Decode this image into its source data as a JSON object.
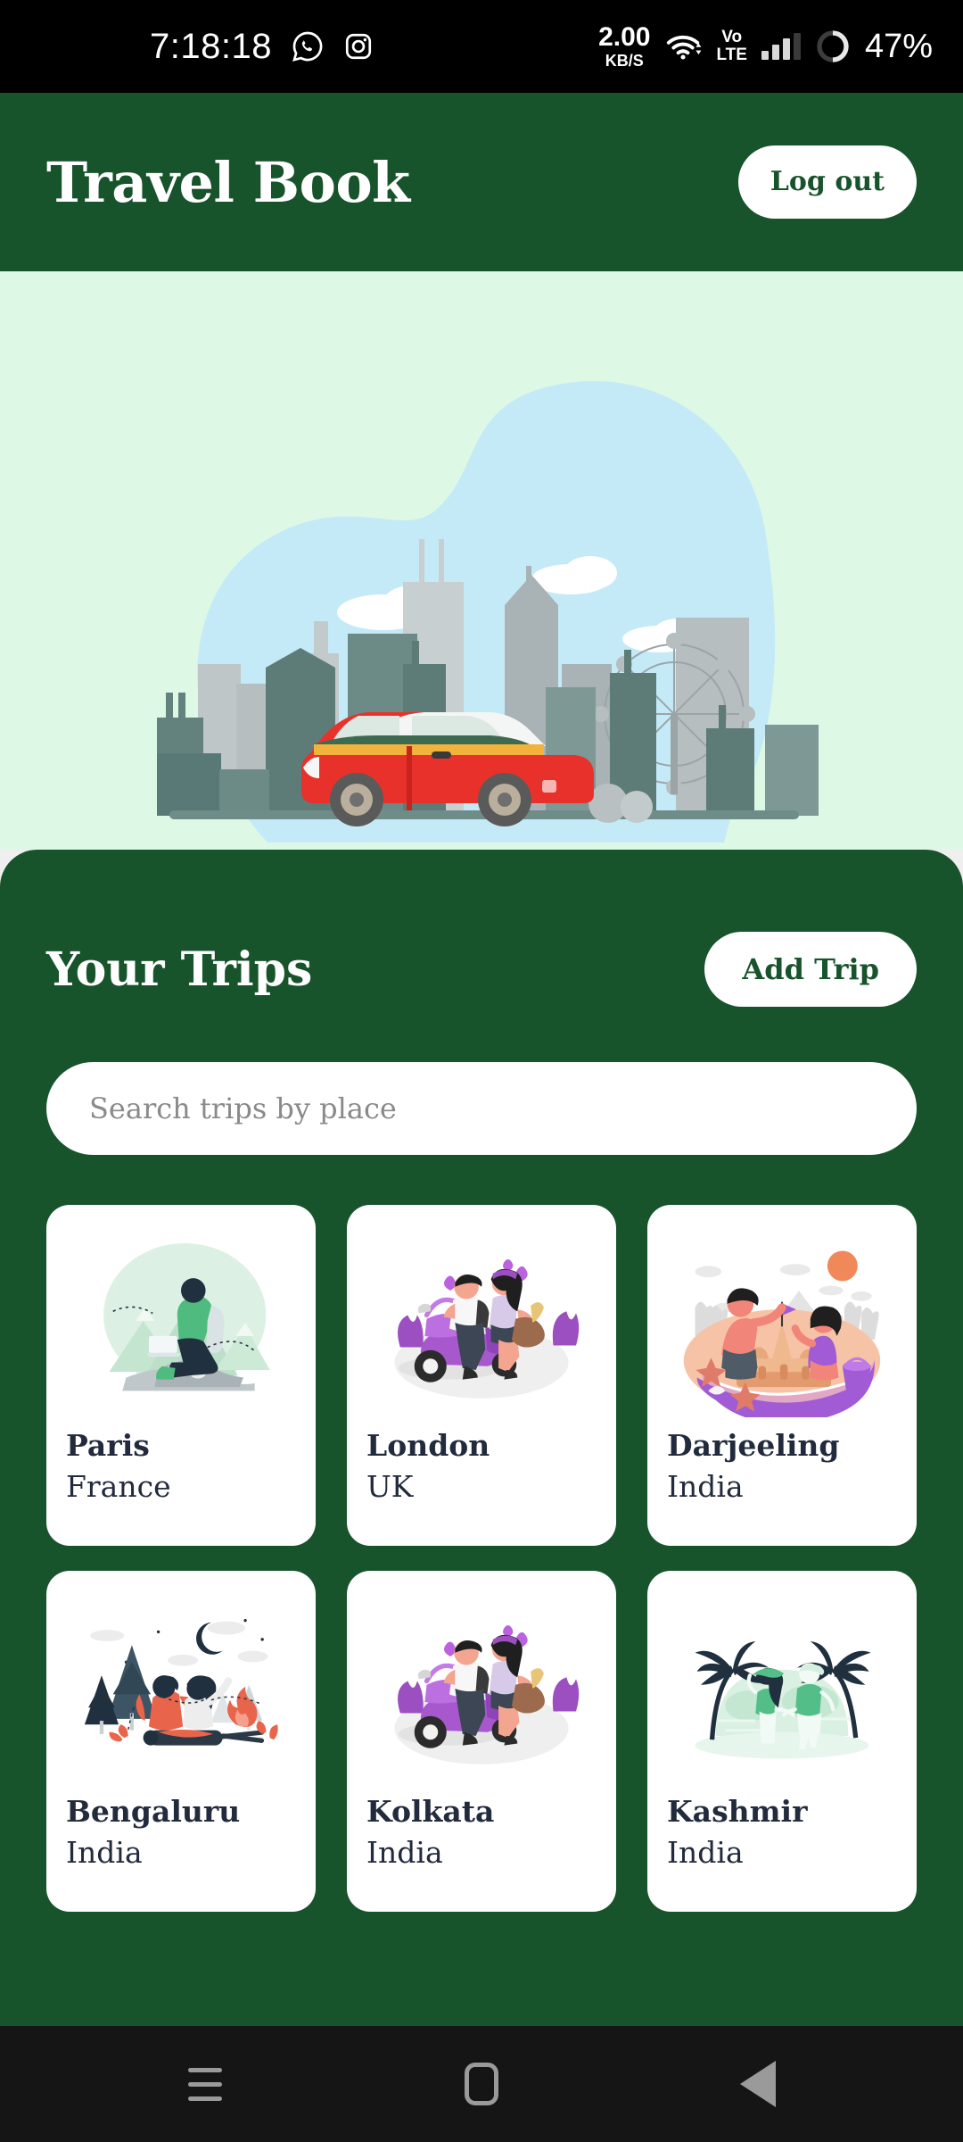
{
  "statusbar": {
    "clock": "7:18:18",
    "app_icons": [
      "whatsapp-icon",
      "instagram-icon"
    ],
    "network_speed_value": "2.00",
    "network_speed_unit": "KB/S",
    "wifi_icon": "wifi-icon",
    "volte_top": "Vo",
    "volte_bottom": "LTE",
    "signal_icon": "signal-bars-icon",
    "battery_icon": "battery-circle-icon",
    "battery_percent": "47%"
  },
  "header": {
    "title": "Travel Book",
    "logout_label": "Log out"
  },
  "hero": {
    "illustration": "city-skyline-with-red-car-illustration",
    "background_color": "#DEF8E6",
    "sky_color": "#C5EAF7"
  },
  "panel": {
    "background_color": "#17532B",
    "title": "Your Trips",
    "add_trip_label": "Add Trip",
    "search": {
      "placeholder": "Search trips by place",
      "value": ""
    }
  },
  "trips": [
    {
      "city": "Paris",
      "country": "France",
      "art": "mountain-hiker-illustration"
    },
    {
      "city": "London",
      "country": "UK",
      "art": "scooter-couple-illustration"
    },
    {
      "city": "Darjeeling",
      "country": "India",
      "art": "beach-sandcastle-illustration"
    },
    {
      "city": "Bengaluru",
      "country": "India",
      "art": "campfire-night-illustration"
    },
    {
      "city": "Kolkata",
      "country": "India",
      "art": "scooter-couple-illustration"
    },
    {
      "city": "Kashmir",
      "country": "India",
      "art": "palm-beach-couple-illustration"
    }
  ],
  "navbar": {
    "recents_icon": "recents-icon",
    "home_icon": "home-icon",
    "back_icon": "back-icon"
  },
  "colors": {
    "brand_green": "#17532B",
    "hero_mint": "#DEF8E6",
    "card_white": "#FFFFFF",
    "text_navy": "#222B3D",
    "placeholder_grey": "#8A8A8A"
  }
}
